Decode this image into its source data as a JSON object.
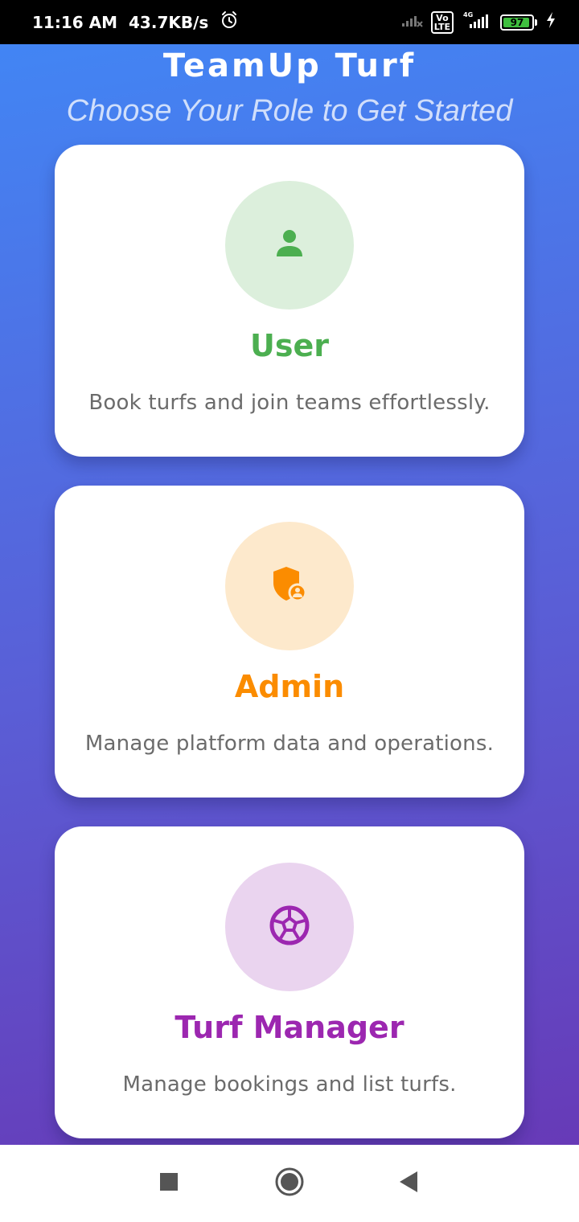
{
  "status_bar": {
    "time": "11:16 AM",
    "speed": "43.7KB/s",
    "alarm_icon": "alarm-clock-icon",
    "volte_label": "Vo\nLTE",
    "network_label": "4G",
    "battery_level": "97",
    "charging_icon": "lightning-icon"
  },
  "header": {
    "title": "TeamUp Turf",
    "subtitle": "Choose Your Role to Get Started"
  },
  "roles": [
    {
      "title": "User",
      "description": "Book turfs and join teams effortlessly.",
      "icon": "person-icon",
      "accent_color": "#4caf50",
      "icon_bg_color": "#dcefdc"
    },
    {
      "title": "Admin",
      "description": "Manage platform data and operations.",
      "icon": "admin-shield-icon",
      "accent_color": "#fb8c00",
      "icon_bg_color": "#fde9cc"
    },
    {
      "title": "Turf Manager",
      "description": "Manage bookings and list turfs.",
      "icon": "soccer-ball-icon",
      "accent_color": "#9c27b0",
      "icon_bg_color": "#ead4ef"
    }
  ],
  "navigation": {
    "recents_icon": "square-icon",
    "home_icon": "circle-home-icon",
    "back_icon": "triangle-back-icon"
  },
  "colors": {
    "gradient_start": "#4285f4",
    "gradient_end": "#673ab7"
  }
}
